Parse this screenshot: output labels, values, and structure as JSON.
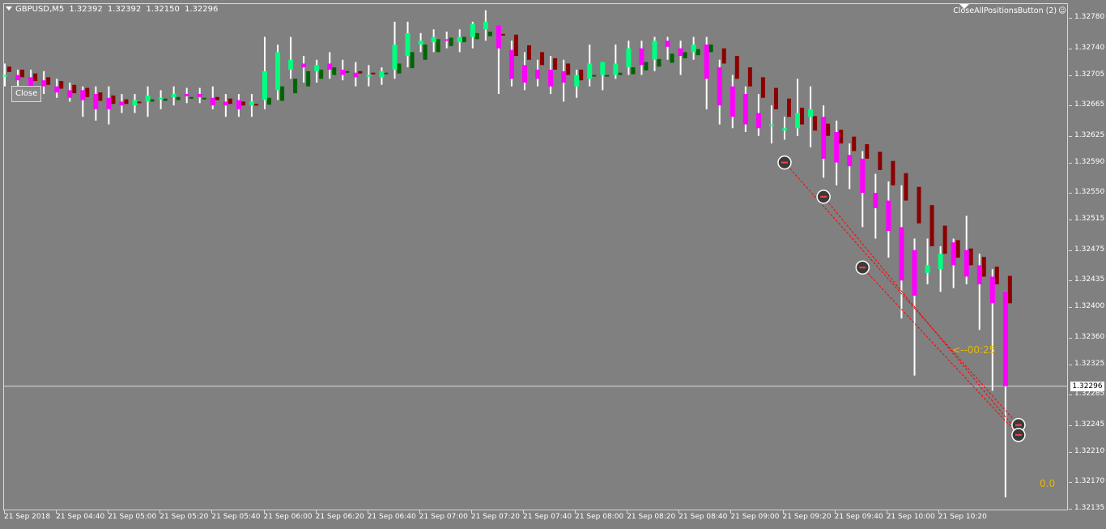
{
  "header": {
    "symbol": "GBPUSD,M5",
    "open": "1.32392",
    "high": "1.32392",
    "low": "1.32150",
    "close": "1.32296"
  },
  "close_button": "Close",
  "ea_label": "CloseAllPositionsButton (2)",
  "ea_icon": "smiley-icon",
  "timer": "<--00:25",
  "zero_label": "0.0",
  "current_price": "1.32296",
  "price_axis": [
    "1.32780",
    "1.32740",
    "1.32705",
    "1.32665",
    "1.32625",
    "1.32590",
    "1.32550",
    "1.32515",
    "1.32475",
    "1.32435",
    "1.32400",
    "1.32360",
    "1.32325",
    "1.32285",
    "1.32245",
    "1.32210",
    "1.32170",
    "1.32135"
  ],
  "time_axis": [
    "21 Sep 2018",
    "21 Sep 04:40",
    "21 Sep 05:00",
    "21 Sep 05:20",
    "21 Sep 05:40",
    "21 Sep 06:00",
    "21 Sep 06:20",
    "21 Sep 06:40",
    "21 Sep 07:00",
    "21 Sep 07:20",
    "21 Sep 07:40",
    "21 Sep 08:00",
    "21 Sep 08:20",
    "21 Sep 08:40",
    "21 Sep 09:00",
    "21 Sep 09:20",
    "21 Sep 09:40",
    "21 Sep 10:00",
    "21 Sep 10:20"
  ],
  "colors": {
    "background": "#808080",
    "bull_body": "#00ff7f",
    "bear_body": "#ff00ff",
    "wick": "#ffffff",
    "ha_bull": "#006400",
    "ha_bear": "#8b0000",
    "trade_line": "#ff0000",
    "timer": "#e8b800"
  },
  "chart_data": {
    "type": "candlestick",
    "symbol": "GBPUSD",
    "timeframe": "M5",
    "ylim": [
      1.32135,
      1.32795
    ],
    "candles": [
      {
        "o": 1.32705,
        "h": 1.3272,
        "l": 1.3269,
        "c": 1.32705
      },
      {
        "o": 1.32705,
        "h": 1.32712,
        "l": 1.3269,
        "c": 1.32698
      },
      {
        "o": 1.32702,
        "h": 1.32712,
        "l": 1.32682,
        "c": 1.3269
      },
      {
        "o": 1.32698,
        "h": 1.3271,
        "l": 1.3268,
        "c": 1.3269
      },
      {
        "o": 1.3269,
        "h": 1.327,
        "l": 1.32675,
        "c": 1.32682
      },
      {
        "o": 1.32685,
        "h": 1.32695,
        "l": 1.3267,
        "c": 1.32675
      },
      {
        "o": 1.32685,
        "h": 1.3269,
        "l": 1.3265,
        "c": 1.32672
      },
      {
        "o": 1.3268,
        "h": 1.3269,
        "l": 1.32645,
        "c": 1.3266
      },
      {
        "o": 1.32675,
        "h": 1.3269,
        "l": 1.3264,
        "c": 1.3266
      },
      {
        "o": 1.3267,
        "h": 1.3268,
        "l": 1.32655,
        "c": 1.32665
      },
      {
        "o": 1.32665,
        "h": 1.3268,
        "l": 1.32655,
        "c": 1.32672
      },
      {
        "o": 1.3267,
        "h": 1.3269,
        "l": 1.3265,
        "c": 1.32678
      },
      {
        "o": 1.32675,
        "h": 1.32685,
        "l": 1.3266,
        "c": 1.32675
      },
      {
        "o": 1.32676,
        "h": 1.3269,
        "l": 1.32665,
        "c": 1.3268
      },
      {
        "o": 1.3268,
        "h": 1.32688,
        "l": 1.32668,
        "c": 1.32677
      },
      {
        "o": 1.3268,
        "h": 1.32688,
        "l": 1.32668,
        "c": 1.32676
      },
      {
        "o": 1.32675,
        "h": 1.3269,
        "l": 1.3266,
        "c": 1.32665
      },
      {
        "o": 1.3267,
        "h": 1.3268,
        "l": 1.3265,
        "c": 1.32665
      },
      {
        "o": 1.32672,
        "h": 1.3268,
        "l": 1.3265,
        "c": 1.3266
      },
      {
        "o": 1.32665,
        "h": 1.3268,
        "l": 1.3265,
        "c": 1.3267
      },
      {
        "o": 1.32672,
        "h": 1.32755,
        "l": 1.3266,
        "c": 1.3271
      },
      {
        "o": 1.32685,
        "h": 1.32745,
        "l": 1.32672,
        "c": 1.32735
      },
      {
        "o": 1.32712,
        "h": 1.32755,
        "l": 1.327,
        "c": 1.32725
      },
      {
        "o": 1.3272,
        "h": 1.3273,
        "l": 1.32695,
        "c": 1.32715
      },
      {
        "o": 1.3271,
        "h": 1.32725,
        "l": 1.32695,
        "c": 1.32718
      },
      {
        "o": 1.3272,
        "h": 1.32735,
        "l": 1.327,
        "c": 1.32712
      },
      {
        "o": 1.32712,
        "h": 1.32725,
        "l": 1.32698,
        "c": 1.32705
      },
      {
        "o": 1.32708,
        "h": 1.32722,
        "l": 1.3269,
        "c": 1.32702
      },
      {
        "o": 1.32705,
        "h": 1.32718,
        "l": 1.3269,
        "c": 1.32705
      },
      {
        "o": 1.32702,
        "h": 1.32715,
        "l": 1.32692,
        "c": 1.3271
      },
      {
        "o": 1.32712,
        "h": 1.32775,
        "l": 1.327,
        "c": 1.32745
      },
      {
        "o": 1.3273,
        "h": 1.32775,
        "l": 1.32715,
        "c": 1.3276
      },
      {
        "o": 1.32745,
        "h": 1.3276,
        "l": 1.32735,
        "c": 1.3275
      },
      {
        "o": 1.32748,
        "h": 1.32765,
        "l": 1.32735,
        "c": 1.32755
      },
      {
        "o": 1.32752,
        "h": 1.32762,
        "l": 1.3274,
        "c": 1.3275
      },
      {
        "o": 1.32748,
        "h": 1.32765,
        "l": 1.32735,
        "c": 1.32755
      },
      {
        "o": 1.32755,
        "h": 1.32775,
        "l": 1.3274,
        "c": 1.32772
      },
      {
        "o": 1.32765,
        "h": 1.3279,
        "l": 1.3275,
        "c": 1.32775
      },
      {
        "o": 1.3277,
        "h": 1.3277,
        "l": 1.3268,
        "c": 1.3274
      },
      {
        "o": 1.32738,
        "h": 1.3275,
        "l": 1.3269,
        "c": 1.327
      },
      {
        "o": 1.32718,
        "h": 1.32735,
        "l": 1.32685,
        "c": 1.32695
      },
      {
        "o": 1.32712,
        "h": 1.32725,
        "l": 1.3269,
        "c": 1.327
      },
      {
        "o": 1.32712,
        "h": 1.3273,
        "l": 1.3268,
        "c": 1.3269
      },
      {
        "o": 1.3271,
        "h": 1.32725,
        "l": 1.3267,
        "c": 1.32695
      },
      {
        "o": 1.3269,
        "h": 1.32712,
        "l": 1.32675,
        "c": 1.32705
      },
      {
        "o": 1.327,
        "h": 1.32745,
        "l": 1.3269,
        "c": 1.3272
      },
      {
        "o": 1.32705,
        "h": 1.3272,
        "l": 1.32685,
        "c": 1.32722
      },
      {
        "o": 1.32705,
        "h": 1.32745,
        "l": 1.327,
        "c": 1.3272
      },
      {
        "o": 1.32715,
        "h": 1.3275,
        "l": 1.32705,
        "c": 1.3274
      },
      {
        "o": 1.3274,
        "h": 1.3275,
        "l": 1.32705,
        "c": 1.32718
      },
      {
        "o": 1.32725,
        "h": 1.32755,
        "l": 1.3271,
        "c": 1.3275
      },
      {
        "o": 1.3275,
        "h": 1.32755,
        "l": 1.32725,
        "c": 1.32742
      },
      {
        "o": 1.3274,
        "h": 1.3275,
        "l": 1.32705,
        "c": 1.3273
      },
      {
        "o": 1.32735,
        "h": 1.32755,
        "l": 1.32725,
        "c": 1.32745
      },
      {
        "o": 1.32745,
        "h": 1.32755,
        "l": 1.3266,
        "c": 1.327
      },
      {
        "o": 1.32715,
        "h": 1.32725,
        "l": 1.3264,
        "c": 1.32665
      },
      {
        "o": 1.3269,
        "h": 1.32705,
        "l": 1.32635,
        "c": 1.3265
      },
      {
        "o": 1.3268,
        "h": 1.3269,
        "l": 1.3263,
        "c": 1.3264
      },
      {
        "o": 1.32655,
        "h": 1.3268,
        "l": 1.32625,
        "c": 1.32635
      },
      {
        "o": 1.3264,
        "h": 1.32665,
        "l": 1.32615,
        "c": 1.3264
      },
      {
        "o": 1.32632,
        "h": 1.3265,
        "l": 1.3262,
        "c": 1.32635
      },
      {
        "o": 1.32635,
        "h": 1.327,
        "l": 1.32625,
        "c": 1.32655
      },
      {
        "o": 1.3265,
        "h": 1.3269,
        "l": 1.3261,
        "c": 1.3266
      },
      {
        "o": 1.3265,
        "h": 1.32665,
        "l": 1.3257,
        "c": 1.32595
      },
      {
        "o": 1.3263,
        "h": 1.32645,
        "l": 1.3256,
        "c": 1.3259
      },
      {
        "o": 1.326,
        "h": 1.32615,
        "l": 1.32555,
        "c": 1.32585
      },
      {
        "o": 1.32595,
        "h": 1.32605,
        "l": 1.32505,
        "c": 1.3255
      },
      {
        "o": 1.3255,
        "h": 1.32575,
        "l": 1.3249,
        "c": 1.3253
      },
      {
        "o": 1.3254,
        "h": 1.32565,
        "l": 1.32465,
        "c": 1.325
      },
      {
        "o": 1.32505,
        "h": 1.3256,
        "l": 1.32385,
        "c": 1.32435
      },
      {
        "o": 1.32475,
        "h": 1.3249,
        "l": 1.3231,
        "c": 1.32415
      },
      {
        "o": 1.32445,
        "h": 1.3249,
        "l": 1.3243,
        "c": 1.32455
      },
      {
        "o": 1.3245,
        "h": 1.3248,
        "l": 1.3242,
        "c": 1.3247
      },
      {
        "o": 1.32485,
        "h": 1.3249,
        "l": 1.32425,
        "c": 1.32455
      },
      {
        "o": 1.32475,
        "h": 1.3252,
        "l": 1.3243,
        "c": 1.3244
      },
      {
        "o": 1.32455,
        "h": 1.3247,
        "l": 1.3237,
        "c": 1.3243
      },
      {
        "o": 1.3244,
        "h": 1.3245,
        "l": 1.3229,
        "c": 1.32405
      },
      {
        "o": 1.3242,
        "h": 1.3242,
        "l": 1.3215,
        "c": 1.32296
      }
    ],
    "heiken_ashi": [
      {
        "o": 1.32716,
        "c": 1.32709
      },
      {
        "o": 1.32712,
        "c": 1.32702
      },
      {
        "o": 1.32707,
        "c": 1.32697
      },
      {
        "o": 1.32702,
        "c": 1.32692
      },
      {
        "o": 1.32697,
        "c": 1.32687
      },
      {
        "o": 1.32692,
        "c": 1.32681
      },
      {
        "o": 1.32688,
        "c": 1.32676
      },
      {
        "o": 1.32682,
        "c": 1.32671
      },
      {
        "o": 1.32678,
        "c": 1.32667
      },
      {
        "o": 1.32673,
        "c": 1.32667
      },
      {
        "o": 1.3267,
        "c": 1.32668
      },
      {
        "o": 1.3267,
        "c": 1.32673
      },
      {
        "o": 1.32671,
        "c": 1.32674
      },
      {
        "o": 1.32672,
        "c": 1.32676
      },
      {
        "o": 1.32675,
        "c": 1.32676
      },
      {
        "o": 1.32675,
        "c": 1.32675
      },
      {
        "o": 1.32676,
        "c": 1.32672
      },
      {
        "o": 1.32674,
        "c": 1.32667
      },
      {
        "o": 1.3267,
        "c": 1.32665
      },
      {
        "o": 1.32667,
        "c": 1.32665
      },
      {
        "o": 1.32666,
        "c": 1.32675
      },
      {
        "o": 1.32671,
        "c": 1.3269
      },
      {
        "o": 1.32681,
        "c": 1.327
      },
      {
        "o": 1.3269,
        "c": 1.3271
      },
      {
        "o": 1.327,
        "c": 1.32712
      },
      {
        "o": 1.32705,
        "c": 1.32715
      },
      {
        "o": 1.3271,
        "c": 1.3271
      },
      {
        "o": 1.3271,
        "c": 1.32707
      },
      {
        "o": 1.32708,
        "c": 1.32706
      },
      {
        "o": 1.32707,
        "c": 1.32708
      },
      {
        "o": 1.32707,
        "c": 1.3272
      },
      {
        "o": 1.32714,
        "c": 1.32735
      },
      {
        "o": 1.32725,
        "c": 1.32745
      },
      {
        "o": 1.32735,
        "c": 1.32752
      },
      {
        "o": 1.32743,
        "c": 1.32754
      },
      {
        "o": 1.32748,
        "c": 1.32755
      },
      {
        "o": 1.32752,
        "c": 1.3276
      },
      {
        "o": 1.32756,
        "c": 1.32762
      },
      {
        "o": 1.32759,
        "c": 1.32758
      },
      {
        "o": 1.32758,
        "c": 1.3273
      },
      {
        "o": 1.32744,
        "c": 1.32725
      },
      {
        "o": 1.32735,
        "c": 1.32718
      },
      {
        "o": 1.32727,
        "c": 1.32712
      },
      {
        "o": 1.3272,
        "c": 1.32705
      },
      {
        "o": 1.32712,
        "c": 1.32698
      },
      {
        "o": 1.32705,
        "c": 1.32705
      },
      {
        "o": 1.32705,
        "c": 1.32705
      },
      {
        "o": 1.32705,
        "c": 1.32708
      },
      {
        "o": 1.32706,
        "c": 1.32715
      },
      {
        "o": 1.32711,
        "c": 1.32722
      },
      {
        "o": 1.32716,
        "c": 1.32726
      },
      {
        "o": 1.32721,
        "c": 1.32733
      },
      {
        "o": 1.32727,
        "c": 1.32735
      },
      {
        "o": 1.32731,
        "c": 1.32739
      },
      {
        "o": 1.32735,
        "c": 1.32745
      },
      {
        "o": 1.3274,
        "c": 1.3272
      },
      {
        "o": 1.3273,
        "c": 1.327
      },
      {
        "o": 1.32715,
        "c": 1.3269
      },
      {
        "o": 1.32702,
        "c": 1.32675
      },
      {
        "o": 1.32688,
        "c": 1.3266
      },
      {
        "o": 1.32674,
        "c": 1.3265
      },
      {
        "o": 1.32662,
        "c": 1.3264
      },
      {
        "o": 1.32651,
        "c": 1.32632
      },
      {
        "o": 1.32641,
        "c": 1.32625
      },
      {
        "o": 1.32633,
        "c": 1.32615
      },
      {
        "o": 1.32624,
        "c": 1.32605
      },
      {
        "o": 1.32614,
        "c": 1.32595
      },
      {
        "o": 1.32604,
        "c": 1.3258
      },
      {
        "o": 1.32592,
        "c": 1.3256
      },
      {
        "o": 1.32576,
        "c": 1.3254
      },
      {
        "o": 1.32558,
        "c": 1.3251
      },
      {
        "o": 1.32534,
        "c": 1.3248
      },
      {
        "o": 1.32507,
        "c": 1.3247
      },
      {
        "o": 1.32488,
        "c": 1.32465
      },
      {
        "o": 1.32477,
        "c": 1.32455
      },
      {
        "o": 1.32466,
        "c": 1.3244
      },
      {
        "o": 1.32453,
        "c": 1.3243
      },
      {
        "o": 1.32441,
        "c": 1.32405
      }
    ],
    "trades": [
      {
        "from_index": 60,
        "from_price": 1.3259,
        "to_index": 78,
        "to_price": 1.32245
      },
      {
        "from_index": 63,
        "from_price": 1.32545,
        "to_index": 78,
        "to_price": 1.32235
      },
      {
        "from_index": 66,
        "from_price": 1.32452,
        "to_index": 78,
        "to_price": 1.32232
      }
    ],
    "entry_markers": [
      {
        "index": 60,
        "price": 1.3259
      },
      {
        "index": 63,
        "price": 1.32545
      },
      {
        "index": 66,
        "price": 1.32452
      },
      {
        "index": 78,
        "price": 1.32245
      },
      {
        "index": 78,
        "price": 1.32232
      }
    ]
  }
}
